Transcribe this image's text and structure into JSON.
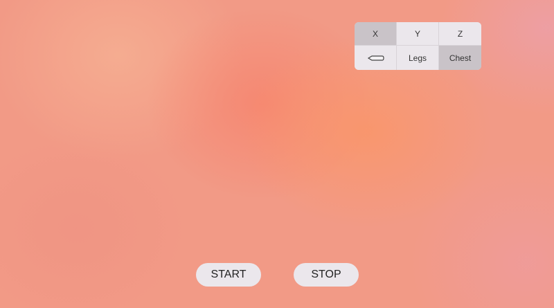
{
  "selector": {
    "axis": [
      {
        "label": "X",
        "selected": true
      },
      {
        "label": "Y",
        "selected": false
      },
      {
        "label": "Z",
        "selected": false
      }
    ],
    "location": [
      {
        "label": "",
        "icon": "arm-icon",
        "selected": false
      },
      {
        "label": "Legs",
        "selected": false
      },
      {
        "label": "Chest",
        "selected": true
      }
    ]
  },
  "controls": {
    "start_label": "START",
    "stop_label": "STOP"
  }
}
